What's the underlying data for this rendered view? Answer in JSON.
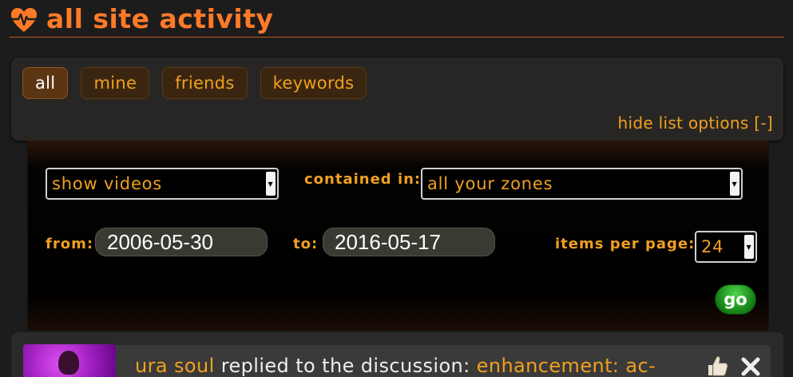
{
  "header": {
    "title": "all site activity",
    "icon": "heart-pulse-icon"
  },
  "tabs": [
    {
      "label": "all",
      "active": true
    },
    {
      "label": "mine",
      "active": false
    },
    {
      "label": "friends",
      "active": false
    },
    {
      "label": "keywords",
      "active": false
    }
  ],
  "list_options": {
    "toggle_label": "hide list options [-]"
  },
  "filters": {
    "show": {
      "value": "show videos"
    },
    "contained_in": {
      "label": "contained in:",
      "value": "all your zones"
    },
    "from": {
      "label": "from:",
      "value": "2006-05-30"
    },
    "to": {
      "label": "to:",
      "value": "2016-05-17"
    },
    "items_per_page": {
      "label": "items per page:",
      "value": "24"
    },
    "go_label": "go"
  },
  "activity": {
    "user": "ura soul",
    "action": " replied to the discussion: ",
    "target": "enhancement: ac-",
    "like_icon": "thumbs-up-icon",
    "dismiss_icon": "close-icon"
  },
  "colors": {
    "accent": "#ff7a28",
    "text_orange": "#f0a020",
    "background": "#1c1c1c",
    "go_green": "#1a8a1a"
  }
}
